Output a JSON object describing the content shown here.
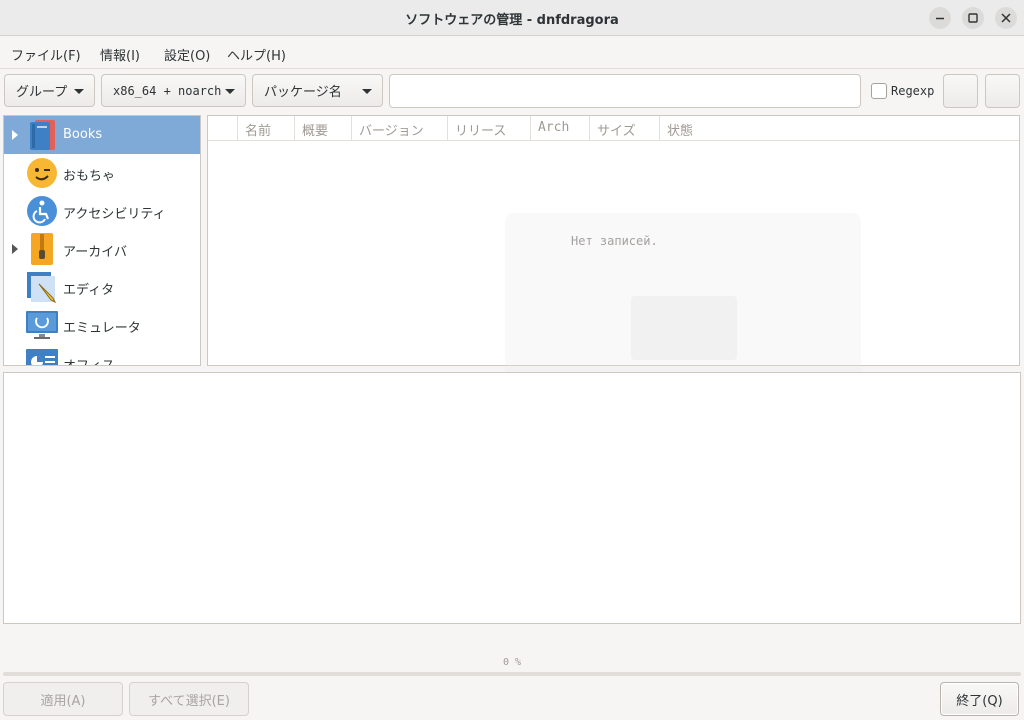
{
  "window": {
    "title": "ソフトウェアの管理 - dnfdragora"
  },
  "menu": {
    "items": [
      "ファイル(F)",
      "情報(I)",
      "設定(O)",
      "ヘルプ(H)"
    ]
  },
  "toolbar": {
    "group_combo": "グループ",
    "arch_combo": "x86_64 + noarch",
    "field_combo": "パッケージ名",
    "search_value": "",
    "regexp_label": "Regexp",
    "regexp_checked": false
  },
  "categories": [
    {
      "label": "Books",
      "expandable": true,
      "selected": true,
      "icon": "books-icon"
    },
    {
      "label": "おもちゃ",
      "expandable": false,
      "selected": false,
      "icon": "toys-icon"
    },
    {
      "label": "アクセシビリティ",
      "expandable": false,
      "selected": false,
      "icon": "accessibility-icon"
    },
    {
      "label": "アーカイバ",
      "expandable": true,
      "selected": false,
      "icon": "archiver-icon"
    },
    {
      "label": "エディタ",
      "expandable": false,
      "selected": false,
      "icon": "editor-icon"
    },
    {
      "label": "エミュレータ",
      "expandable": false,
      "selected": false,
      "icon": "emulator-icon"
    },
    {
      "label": "オフィス",
      "expandable": false,
      "selected": false,
      "icon": "office-icon"
    }
  ],
  "package_list": {
    "columns": [
      "",
      "名前",
      "概要",
      "バージョン",
      "リリース",
      "Arch",
      "サイズ",
      "状態"
    ],
    "empty_message": "Нет записей."
  },
  "progress": {
    "text": "0 %",
    "value": 0
  },
  "buttons": {
    "apply": "適用(A)",
    "select_all": "すべて選択(E)",
    "quit": "終了(Q)"
  },
  "colors": {
    "selection": "#7fa9d6",
    "accent": "#3584e4"
  }
}
